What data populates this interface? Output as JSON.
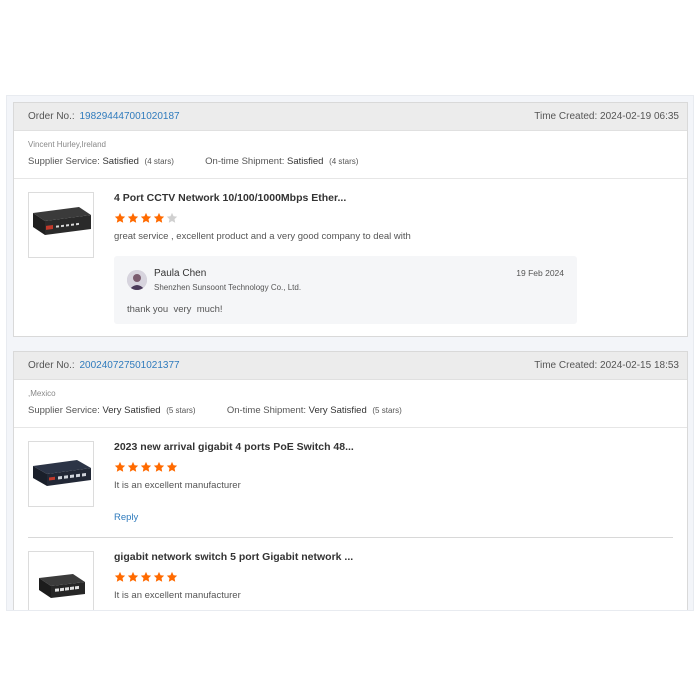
{
  "colors": {
    "accent": "#2f7bbd",
    "star": "#ff6a00",
    "star_empty": "#d0d0d0"
  },
  "orders": [
    {
      "order_label": "Order No.:",
      "order_number": "198294447001020187",
      "time_label": "Time Created:",
      "time_value": "2024-02-19 06:35",
      "buyer": "Vincent Hurley,Ireland",
      "supplier_label": "Supplier Service:",
      "supplier_value": "Satisfied",
      "supplier_stars": "(4 stars)",
      "shipment_label": "On-time Shipment:",
      "shipment_value": "Satisfied",
      "shipment_stars": "(4 stars)",
      "products": [
        {
          "title": "4 Port CCTV Network 10/100/1000Mbps Ether...",
          "rating": 4,
          "comment": "great service , excellent product and a very good company to deal with",
          "image_icon": "network-switch-icon"
        }
      ],
      "reply": {
        "name": "Paula Chen",
        "company": "Shenzhen Sunsoont Technology Co., Ltd.",
        "date": "19 Feb 2024",
        "text": "thank you  very  much!"
      }
    },
    {
      "order_label": "Order No.:",
      "order_number": "200240727501021377",
      "time_label": "Time Created:",
      "time_value": "2024-02-15 18:53",
      "buyer": ",Mexico",
      "supplier_label": "Supplier Service:",
      "supplier_value": "Very Satisfied",
      "supplier_stars": "(5 stars)",
      "shipment_label": "On-time Shipment:",
      "shipment_value": "Very Satisfied",
      "shipment_stars": "(5 stars)",
      "products": [
        {
          "title": "2023 new arrival gigabit 4 ports PoE Switch 48...",
          "rating": 5,
          "comment": "It is an excellent manufacturer",
          "reply_label": "Reply",
          "image_icon": "poe-switch-icon"
        },
        {
          "title": "gigabit network switch 5 port Gigabit network ...",
          "rating": 5,
          "comment": "It is an excellent manufacturer",
          "image_icon": "gigabit-switch-icon"
        }
      ]
    }
  ]
}
